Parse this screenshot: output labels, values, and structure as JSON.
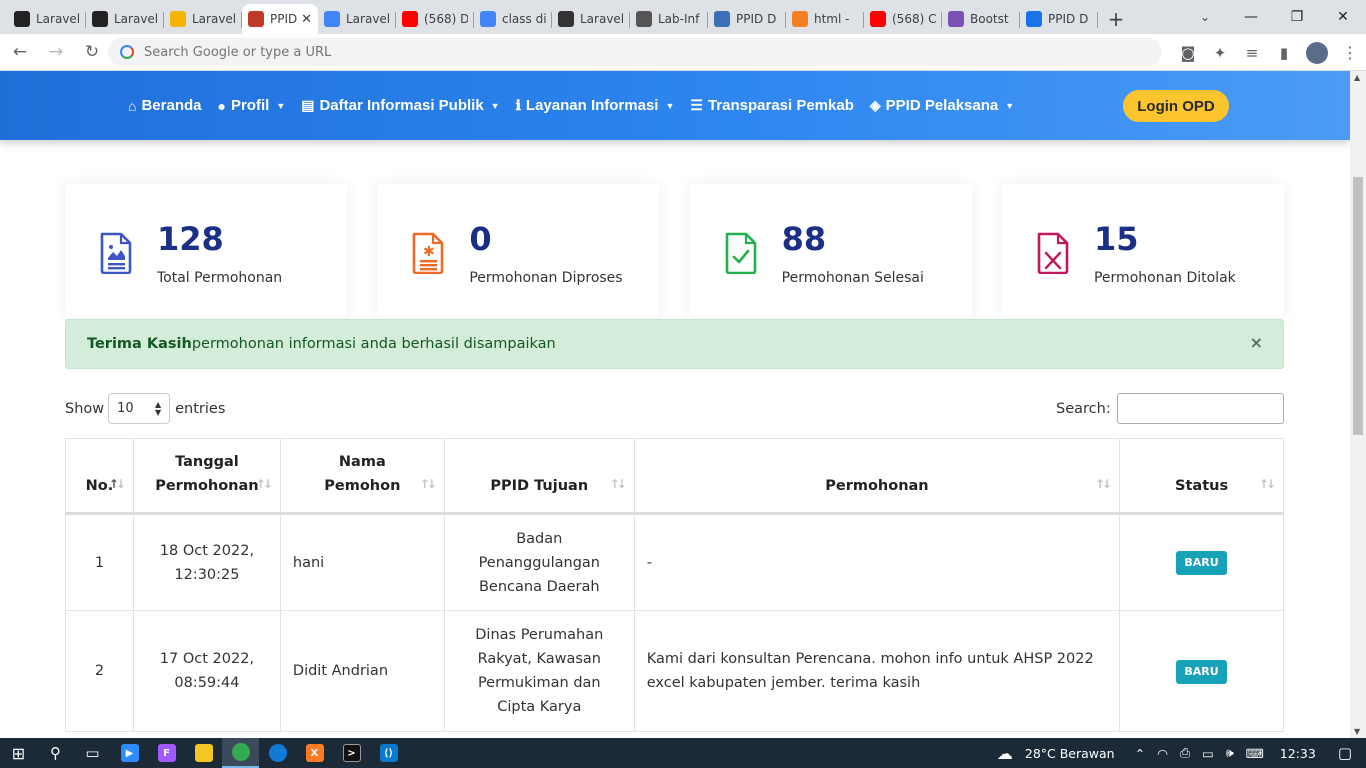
{
  "browser": {
    "tabs": [
      {
        "title": "Laravel",
        "icon": "laravel-icon",
        "color": "#222222"
      },
      {
        "title": "Laravel",
        "icon": "laravel-icon",
        "color": "#222222"
      },
      {
        "title": "Laravel",
        "icon": "chart-icon",
        "color": "#f4b400"
      },
      {
        "title": "PPID",
        "icon": "crest-icon",
        "color": "#c0392b",
        "active": true
      },
      {
        "title": "Laravel",
        "icon": "google-icon",
        "color": "#4285f4"
      },
      {
        "title": "(568) D",
        "icon": "youtube-icon",
        "color": "#ff0000"
      },
      {
        "title": "class di",
        "icon": "google-icon",
        "color": "#4285f4"
      },
      {
        "title": "Laravel",
        "icon": "github-icon",
        "color": "#333333"
      },
      {
        "title": "Lab-Inf",
        "icon": "lab-icon",
        "color": "#555555"
      },
      {
        "title": "PPID D",
        "icon": "crest-icon",
        "color": "#3b6fb6"
      },
      {
        "title": "html -",
        "icon": "stack-icon",
        "color": "#f48024"
      },
      {
        "title": "(568) C",
        "icon": "youtube-icon",
        "color": "#ff0000"
      },
      {
        "title": "Bootst",
        "icon": "bootstrap-icon",
        "color": "#7952b3"
      },
      {
        "title": "PPID D",
        "icon": "edge-icon",
        "color": "#1a73e8"
      }
    ],
    "address_placeholder": "Search Google or type a URL"
  },
  "nav": {
    "items": [
      {
        "label": "Beranda",
        "icon": "home-icon",
        "dropdown": false
      },
      {
        "label": "Profil",
        "icon": "user-icon",
        "dropdown": true
      },
      {
        "label": "Daftar Informasi Publik",
        "icon": "document-icon",
        "dropdown": true
      },
      {
        "label": "Layanan Informasi",
        "icon": "info-icon",
        "dropdown": true
      },
      {
        "label": "Transparasi Pemkab",
        "icon": "server-icon",
        "dropdown": false
      },
      {
        "label": "PPID Pelaksana",
        "icon": "layers-icon",
        "dropdown": true
      }
    ],
    "login_label": "Login OPD"
  },
  "stats": [
    {
      "value": "128",
      "label": "Total Permohonan",
      "color": "#3d56c5"
    },
    {
      "value": "0",
      "label": "Permohonan Diproses",
      "color": "#f06a26"
    },
    {
      "value": "88",
      "label": "Permohonan Selesai",
      "color": "#22b14c"
    },
    {
      "value": "15",
      "label": "Permohonan Ditolak",
      "color": "#c2185b"
    }
  ],
  "alert": {
    "strong": "Terima Kasih",
    "message": "permohonan informasi anda berhasil disampaikan",
    "close": "×"
  },
  "table_controls": {
    "show_label": "Show",
    "entries_value": "10",
    "entries_label": "entries",
    "search_label": "Search:"
  },
  "table": {
    "headers": [
      "No.",
      "Tanggal Permohonan",
      "Nama Pemohon",
      "PPID Tujuan",
      "Permohonan",
      "Status"
    ],
    "rows": [
      {
        "no": "1",
        "tanggal": "18 Oct 2022, 12:30:25",
        "nama": "hani",
        "tujuan": "Badan Penanggulangan Bencana Daerah",
        "permohonan": "-",
        "status": "BARU"
      },
      {
        "no": "2",
        "tanggal": "17 Oct 2022, 08:59:44",
        "nama": "Didit Andrian",
        "tujuan": "Dinas Perumahan Rakyat, Kawasan Permukiman dan Cipta Karya",
        "permohonan": "Kami dari konsultan Perencana. mohon info untuk AHSP 2022 excel kabupaten jember. terima kasih",
        "status": "BARU"
      }
    ]
  },
  "taskbar": {
    "weather": "28°C  Berawan",
    "time": "12:33"
  }
}
